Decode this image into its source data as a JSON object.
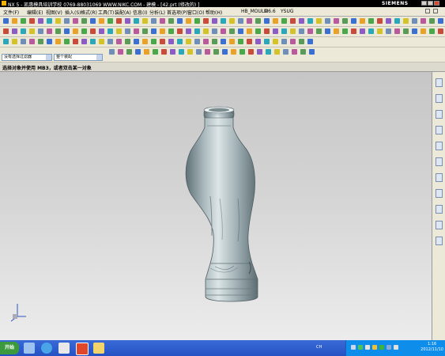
{
  "window": {
    "title": "NX 5 - 凯惠模具培训学校  0769-88031069  WWW.NIKC.COM - 建模 - [42.prt (修改的) ]",
    "brand": "SIEMENS"
  },
  "menu": {
    "items": [
      "文件(F)",
      "编辑(E)",
      "视图(V)",
      "插入(S)",
      "格式(R)",
      "工具(T)",
      "装配(A)",
      "信息(I)",
      "分析(L)",
      "首选项(P)",
      "窗口(O)",
      "帮助(H)",
      "HB_MOULD",
      "M6.6",
      "YSUG"
    ]
  },
  "selection": {
    "filter_value": "没有选择过滤器",
    "scope_value": "整个装配"
  },
  "cue_line": "选择对象并使用 MB3，或者双击某一对象",
  "taskbar": {
    "start_label": "开始",
    "lang": "CH",
    "time": "1:16",
    "date": "2012/11/10"
  },
  "colors": {
    "title_bg": "#000000",
    "taskbar_blue": "#2452c4",
    "bottle_light": "#d2dcdf",
    "bottle_dark": "#6a7b80"
  },
  "icons": {
    "resource_bar": [
      "assembly-navigator-icon",
      "constraint-navigator-icon",
      "part-navigator-icon",
      "reuse-library-icon",
      "web-browser-icon",
      "history-icon",
      "system-materials-icon",
      "process-studio-icon",
      "manufacturing-wizards-icon",
      "roles-icon",
      "system-scenes-icon"
    ],
    "quick_launch": [
      "show-desktop-icon",
      "ie-icon",
      "qq-icon",
      "nx-app-icon",
      "folder-icon"
    ]
  }
}
